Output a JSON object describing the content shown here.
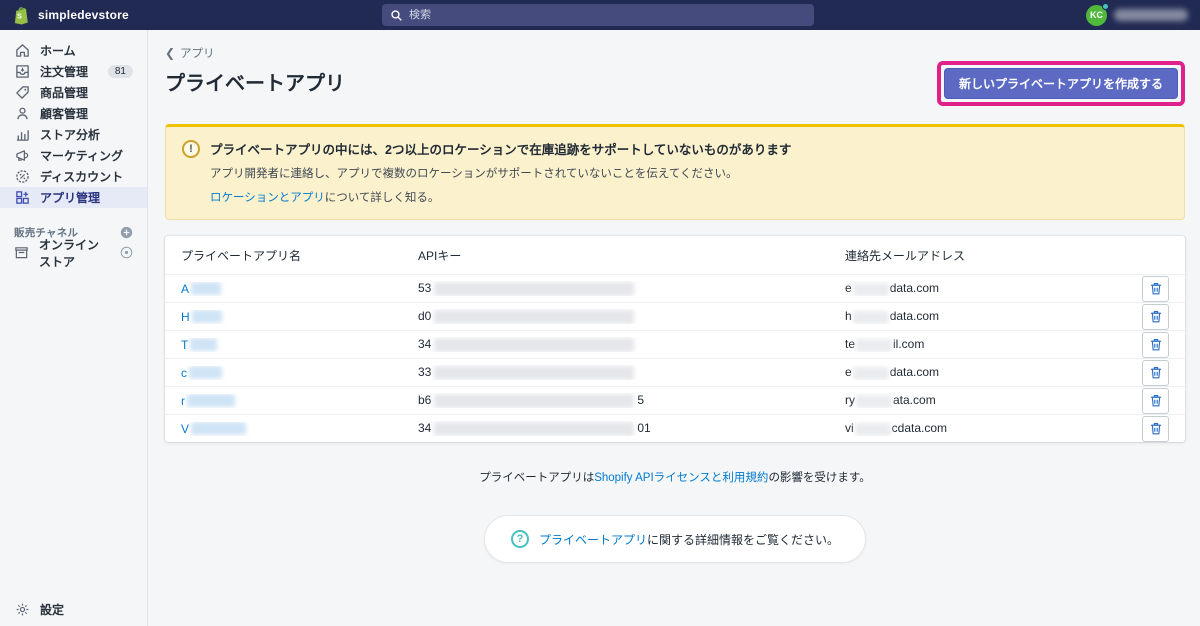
{
  "topbar": {
    "store_name": "simpledevstore",
    "search_placeholder": "検索",
    "avatar_initials": "KC"
  },
  "sidebar": {
    "items": [
      {
        "label": "ホーム",
        "icon": "home-icon"
      },
      {
        "label": "注文管理",
        "icon": "orders-icon",
        "badge": "81"
      },
      {
        "label": "商品管理",
        "icon": "products-icon"
      },
      {
        "label": "顧客管理",
        "icon": "customers-icon"
      },
      {
        "label": "ストア分析",
        "icon": "analytics-icon"
      },
      {
        "label": "マーケティング",
        "icon": "marketing-icon"
      },
      {
        "label": "ディスカウント",
        "icon": "discounts-icon"
      },
      {
        "label": "アプリ管理",
        "icon": "apps-icon",
        "selected": true
      }
    ],
    "sales_channels_header": "販売チャネル",
    "online_store_label": "オンラインストア",
    "settings_label": "設定"
  },
  "page": {
    "breadcrumb": "アプリ",
    "title": "プライベートアプリ",
    "create_button": "新しいプライベートアプリを作成する"
  },
  "banner": {
    "title": "プライベートアプリの中には、2つ以上のロケーションで在庫追跡をサポートしていないものがあります",
    "body": "アプリ開発者に連絡し、アプリで複数のロケーションがサポートされていないことを伝えてください。",
    "link_text": "ロケーションとアプリ",
    "link_suffix": "について詳しく知る。"
  },
  "table": {
    "columns": {
      "name": "プライベートアプリ名",
      "api_key": "APIキー",
      "email": "連絡先メールアドレス"
    },
    "rows": [
      {
        "name_visible": "A",
        "api_prefix": "53",
        "api_suffix": "",
        "email_prefix": "e",
        "email_suffix": "data.com"
      },
      {
        "name_visible": "H",
        "api_prefix": "d0",
        "api_suffix": "",
        "email_prefix": "h",
        "email_suffix": "data.com"
      },
      {
        "name_visible": "T",
        "api_prefix": "34",
        "api_suffix": "",
        "email_prefix": "te",
        "email_suffix": "il.com"
      },
      {
        "name_visible": "c",
        "api_prefix": "33",
        "api_suffix": "",
        "email_prefix": "e",
        "email_suffix": "data.com"
      },
      {
        "name_visible": "r",
        "api_prefix": "b6",
        "api_suffix": "5",
        "email_prefix": "ry",
        "email_suffix": "ata.com"
      },
      {
        "name_visible": "V",
        "api_prefix": "34",
        "api_suffix": "01",
        "email_prefix": "vi",
        "email_suffix": "cdata.com"
      }
    ]
  },
  "footer": {
    "tos_prefix": "プライベートアプリは",
    "tos_link": "Shopify APIライセンスと利用規約",
    "tos_suffix": "の影響を受けます。",
    "help_link": "プライベートアプリ",
    "help_suffix": "に関する詳細情報をご覧ください。"
  },
  "colors": {
    "topbar_bg": "#212a53",
    "primary_button": "#5c6ac4",
    "annotation_highlight": "#e0218a",
    "link_blue": "#007ace",
    "warning_accent": "#eec200",
    "avatar_green": "#50b83c",
    "help_teal": "#47c1bf"
  }
}
